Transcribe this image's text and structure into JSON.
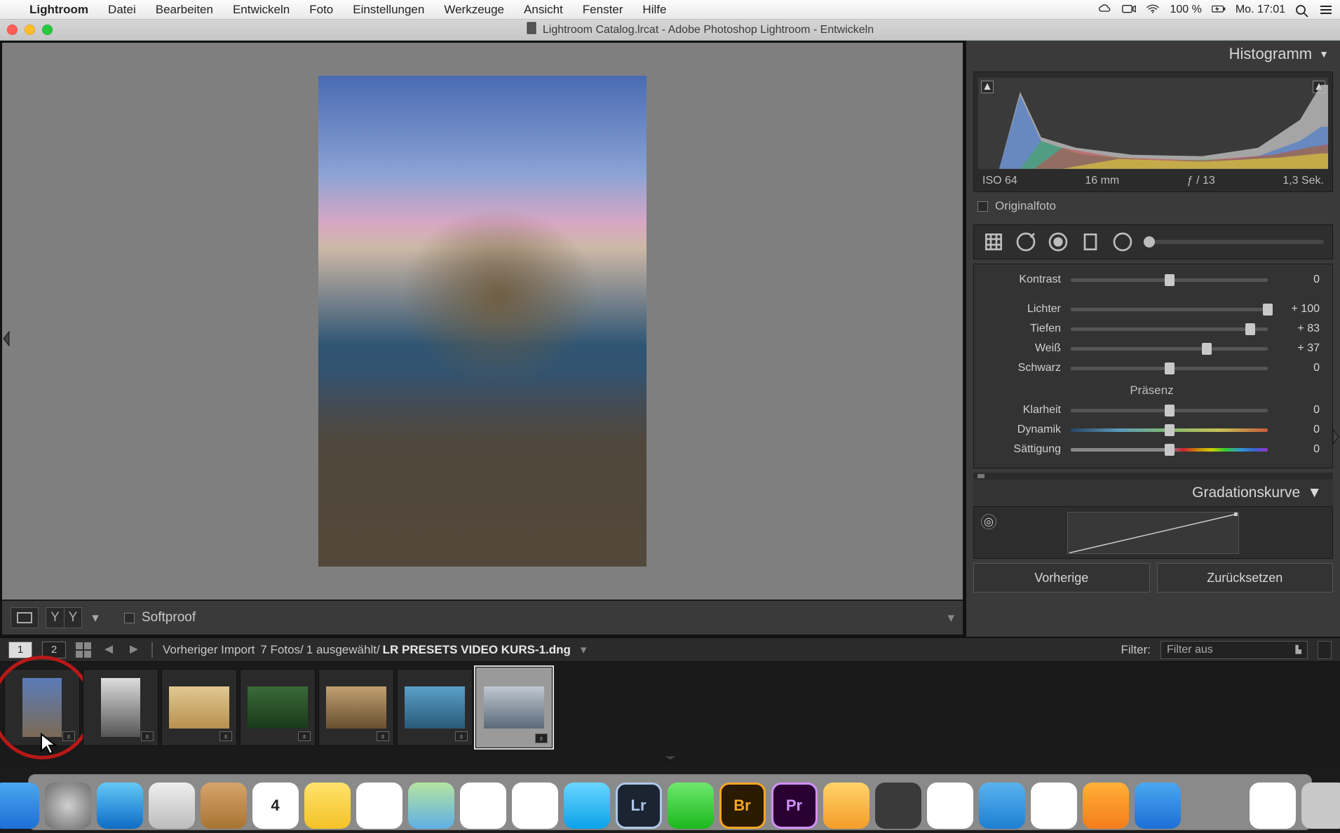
{
  "menubar": {
    "app": "Lightroom",
    "items": [
      "Datei",
      "Bearbeiten",
      "Entwickeln",
      "Foto",
      "Einstellungen",
      "Werkzeuge",
      "Ansicht",
      "Fenster",
      "Hilfe"
    ],
    "battery": "100 %",
    "clock": "Mo. 17:01"
  },
  "titlebar": {
    "title": "Lightroom Catalog.lrcat - Adobe Photoshop Lightroom - Entwickeln"
  },
  "toolbar_bottom": {
    "softproof_label": "Softproof"
  },
  "panel": {
    "histogram_title": "Histogramm",
    "meta": {
      "iso": "ISO 64",
      "focal": "16 mm",
      "aperture": "ƒ / 13",
      "shutter": "1,3 Sek."
    },
    "original_label": "Originalfoto",
    "sliders_top": [
      {
        "label": "Kontrast",
        "value": "0",
        "pos": 50
      }
    ],
    "sliders_light": [
      {
        "label": "Lichter",
        "value": "+ 100",
        "pos": 100
      },
      {
        "label": "Tiefen",
        "value": "+ 83",
        "pos": 91
      },
      {
        "label": "Weiß",
        "value": "+ 37",
        "pos": 69
      },
      {
        "label": "Schwarz",
        "value": "0",
        "pos": 50
      }
    ],
    "presence_title": "Präsenz",
    "sliders_presence": [
      {
        "label": "Klarheit",
        "value": "0",
        "pos": 50,
        "style": ""
      },
      {
        "label": "Dynamik",
        "value": "0",
        "pos": 50,
        "style": "dynamic"
      },
      {
        "label": "Sättigung",
        "value": "0",
        "pos": 50,
        "style": "sat"
      }
    ],
    "curve_title": "Gradationskurve",
    "buttons": {
      "prev": "Vorherige",
      "reset": "Zurücksetzen"
    }
  },
  "filmstrip_header": {
    "screen1": "1",
    "screen2": "2",
    "breadcrumb_source": "Vorheriger Import",
    "breadcrumb_count": "7 Fotos/",
    "breadcrumb_selected": "1 ausgewählt/",
    "breadcrumb_file": "LR PRESETS VIDEO KURS-1.dng",
    "filter_label": "Filter:",
    "filter_value": "Filter aus"
  },
  "thumbnails": [
    {
      "orient": "portrait",
      "sel": false,
      "hl": true
    },
    {
      "orient": "portrait",
      "sel": false,
      "hl": false
    },
    {
      "orient": "land",
      "sel": false,
      "hl": false
    },
    {
      "orient": "land",
      "sel": false,
      "hl": false
    },
    {
      "orient": "land",
      "sel": false,
      "hl": false
    },
    {
      "orient": "land",
      "sel": false,
      "hl": false
    },
    {
      "orient": "land",
      "sel": true,
      "hl": false
    }
  ],
  "dock": [
    {
      "name": "Finder",
      "bg": "linear-gradient(#4aa7ee,#1d6fd6)"
    },
    {
      "name": "Launchpad",
      "bg": "radial-gradient(circle,#d0d0d0,#6a6a6a)"
    },
    {
      "name": "Safari",
      "bg": "linear-gradient(#65c7f7,#0e6cc4)"
    },
    {
      "name": "Mail",
      "bg": "linear-gradient(#eee,#bcbcbc)"
    },
    {
      "name": "Contacts",
      "bg": "linear-gradient(#d6a36a,#a87434)"
    },
    {
      "name": "Calendar",
      "bg": "#fff"
    },
    {
      "name": "Notes",
      "bg": "linear-gradient(#ffe36b,#f4c229)"
    },
    {
      "name": "Reminders",
      "bg": "#fff"
    },
    {
      "name": "Maps",
      "bg": "linear-gradient(#b6e3a1,#5fb0e6)"
    },
    {
      "name": "Photos",
      "bg": "#fff"
    },
    {
      "name": "Chrome",
      "bg": "#fff"
    },
    {
      "name": "Messages",
      "bg": "linear-gradient(#69d6ff,#0aa2e8)"
    },
    {
      "name": "Lightroom",
      "bg": "#1b2430"
    },
    {
      "name": "FaceTime",
      "bg": "linear-gradient(#6ee86e,#1cb81c)"
    },
    {
      "name": "Bridge",
      "bg": "#2a1a00"
    },
    {
      "name": "Premiere",
      "bg": "#2a0033"
    },
    {
      "name": "iBooks Author",
      "bg": "linear-gradient(#ffd36b,#f49d29)"
    },
    {
      "name": "iMovie",
      "bg": "#3a3a3a"
    },
    {
      "name": "Numbers",
      "bg": "#fff"
    },
    {
      "name": "Keynote",
      "bg": "linear-gradient(#5ab3ef,#1d7fd3)"
    },
    {
      "name": "iTunes",
      "bg": "#fff"
    },
    {
      "name": "Books",
      "bg": "linear-gradient(#ffb037,#f47d1c)"
    },
    {
      "name": "App Store",
      "bg": "linear-gradient(#4aa7ee,#1d6fd6)"
    },
    {
      "name": "Preferences",
      "bg": "#8a8a8a"
    }
  ],
  "dock_right": [
    {
      "name": "Downloads",
      "bg": "#fff"
    },
    {
      "name": "Trash",
      "bg": "#c8c8c8"
    }
  ]
}
